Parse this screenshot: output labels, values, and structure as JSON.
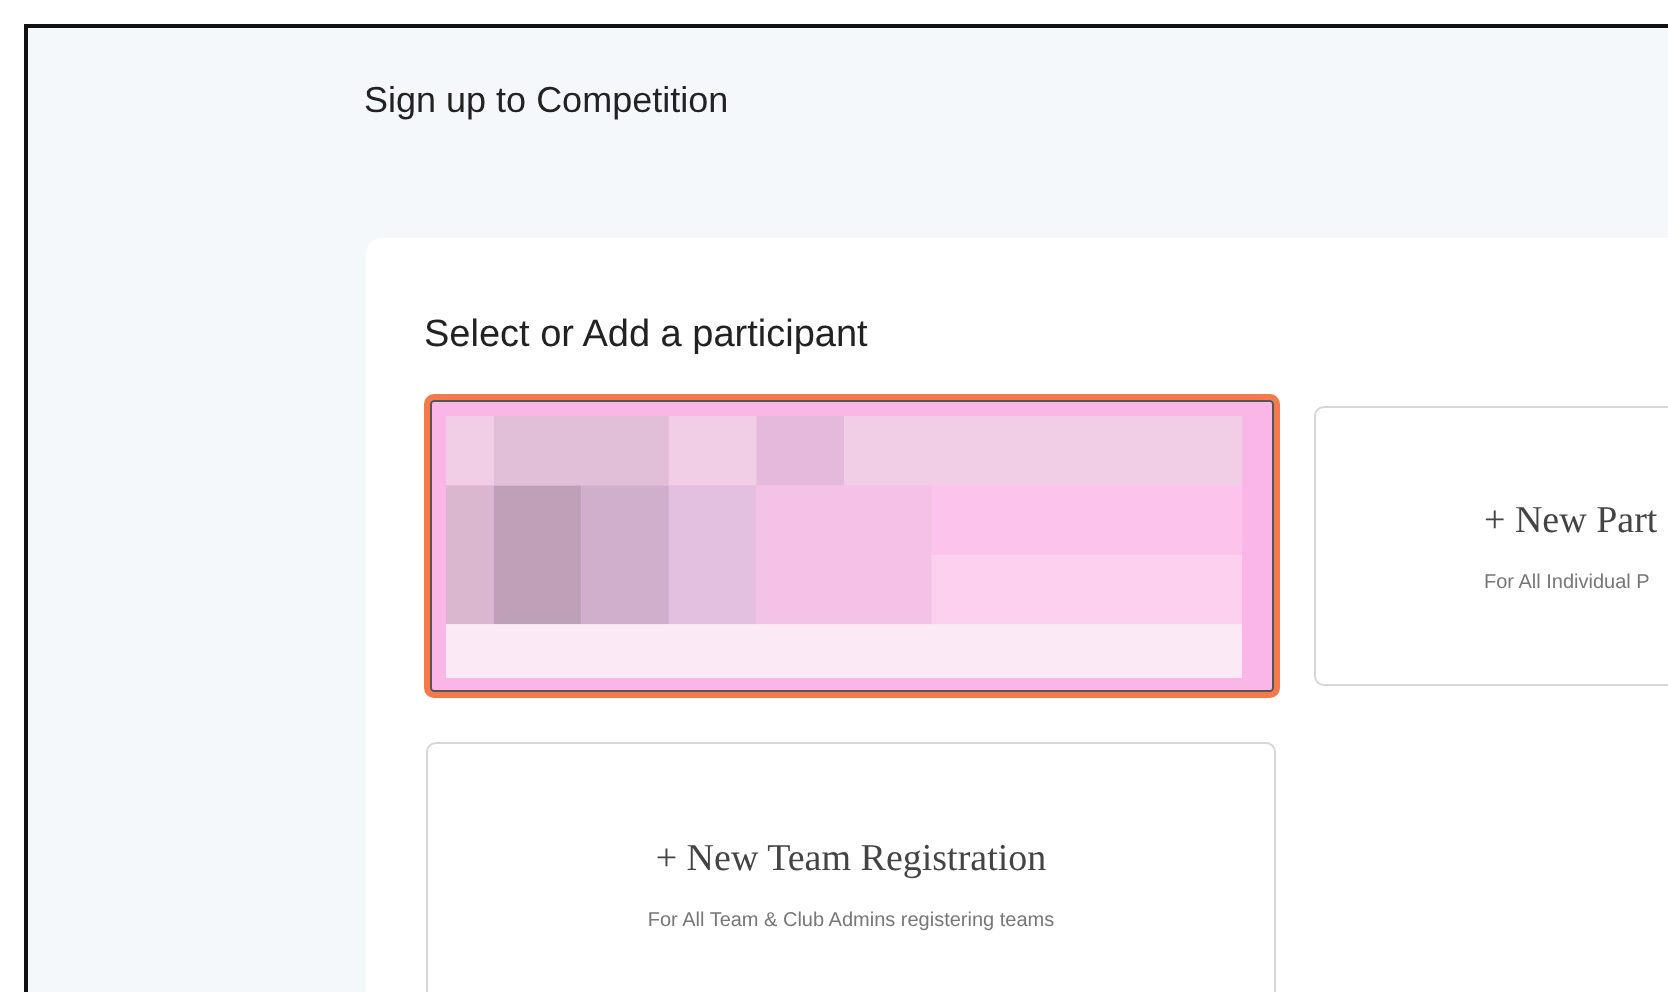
{
  "page": {
    "title": "Sign up to Competition"
  },
  "panel": {
    "heading": "Select or Add a participant"
  },
  "options": [
    {
      "kind": "picture",
      "selected": true
    },
    {
      "kind": "new",
      "title": "+ New Part",
      "subtitle": "For All Individual P",
      "selected": false
    },
    {
      "kind": "new",
      "title": "+ New Team Registration",
      "subtitle": "For All Team & Club Admins registering teams",
      "selected": false
    }
  ]
}
